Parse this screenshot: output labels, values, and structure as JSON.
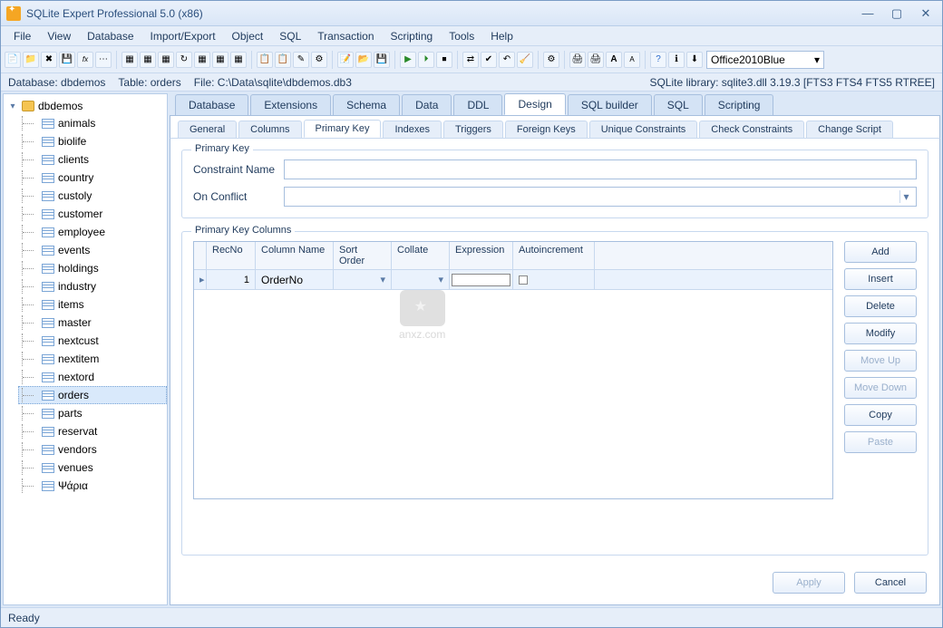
{
  "window": {
    "title": "SQLite Expert Professional 5.0 (x86)"
  },
  "menubar": [
    "File",
    "View",
    "Database",
    "Import/Export",
    "Object",
    "SQL",
    "Transaction",
    "Scripting",
    "Tools",
    "Help"
  ],
  "theme_combo": "Office2010Blue",
  "infobar": {
    "database": "Database: dbdemos",
    "table": "Table: orders",
    "file": "File: C:\\Data\\sqlite\\dbdemos.db3",
    "library": "SQLite library: sqlite3.dll 3.19.3 [FTS3 FTS4 FTS5 RTREE]"
  },
  "tree": {
    "root": "dbdemos",
    "tables": [
      "animals",
      "biolife",
      "clients",
      "country",
      "custoly",
      "customer",
      "employee",
      "events",
      "holdings",
      "industry",
      "items",
      "master",
      "nextcust",
      "nextitem",
      "nextord",
      "orders",
      "parts",
      "reservat",
      "vendors",
      "venues",
      "Ψάρια"
    ],
    "selected": "orders"
  },
  "main_tabs": [
    "Database",
    "Extensions",
    "Schema",
    "Data",
    "DDL",
    "Design",
    "SQL builder",
    "SQL",
    "Scripting"
  ],
  "main_tab_active": "Design",
  "sub_tabs": [
    "General",
    "Columns",
    "Primary Key",
    "Indexes",
    "Triggers",
    "Foreign Keys",
    "Unique Constraints",
    "Check Constraints",
    "Change Script"
  ],
  "sub_tab_active": "Primary Key",
  "pk_form": {
    "group_label": "Primary Key",
    "constraint_label": "Constraint Name",
    "constraint_value": "",
    "onconflict_label": "On Conflict",
    "onconflict_value": ""
  },
  "pk_columns": {
    "group_label": "Primary Key Columns",
    "headers": [
      "RecNo",
      "Column Name",
      "Sort Order",
      "Collate",
      "Expression",
      "Autoincrement"
    ],
    "rows": [
      {
        "recno": "1",
        "column_name": "OrderNo",
        "sort_order": "",
        "collate": "",
        "expression": "",
        "autoincrement": ""
      }
    ]
  },
  "buttons": {
    "add": "Add",
    "insert": "Insert",
    "delete": "Delete",
    "modify": "Modify",
    "moveup": "Move Up",
    "movedown": "Move Down",
    "copy": "Copy",
    "paste": "Paste",
    "apply": "Apply",
    "cancel": "Cancel"
  },
  "statusbar": "Ready",
  "watermark": "anxz.com"
}
